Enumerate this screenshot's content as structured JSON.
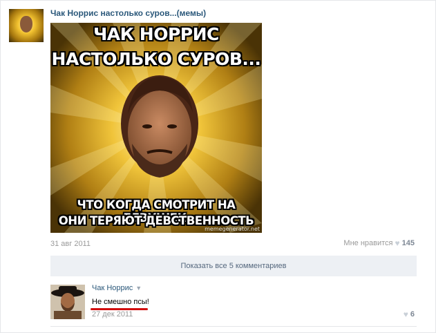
{
  "post": {
    "title": "Чак Норрис настолько суров...(мемы)",
    "date": "31 авг 2011",
    "like_label": "Мне нравится",
    "like_count": "145"
  },
  "meme": {
    "top_line1": "ЧАК НОРРИС",
    "top_line2": "НАСТОЛЬКО СУРОВ...",
    "bottom_line1": "ЧТО КОГДА СМОТРИТ НА ДЕВУШЕК,",
    "bottom_line2": "ОНИ ТЕРЯЮТ ДЕВСТВЕННОСТЬ",
    "watermark": "memegenerator.net"
  },
  "comments": {
    "show_all_label": "Показать все 5 комментариев",
    "items": [
      {
        "author": "Чак Норрис",
        "text": "Не смешно псы!",
        "date": "27 дек 2011",
        "like_count": "6"
      }
    ]
  },
  "icons": {
    "heart": "heart-icon",
    "caret": "chevron-down-icon"
  },
  "colors": {
    "link": "#2b587a",
    "show_bar_bg": "#edf0f4",
    "underline": "#d10e0e"
  }
}
